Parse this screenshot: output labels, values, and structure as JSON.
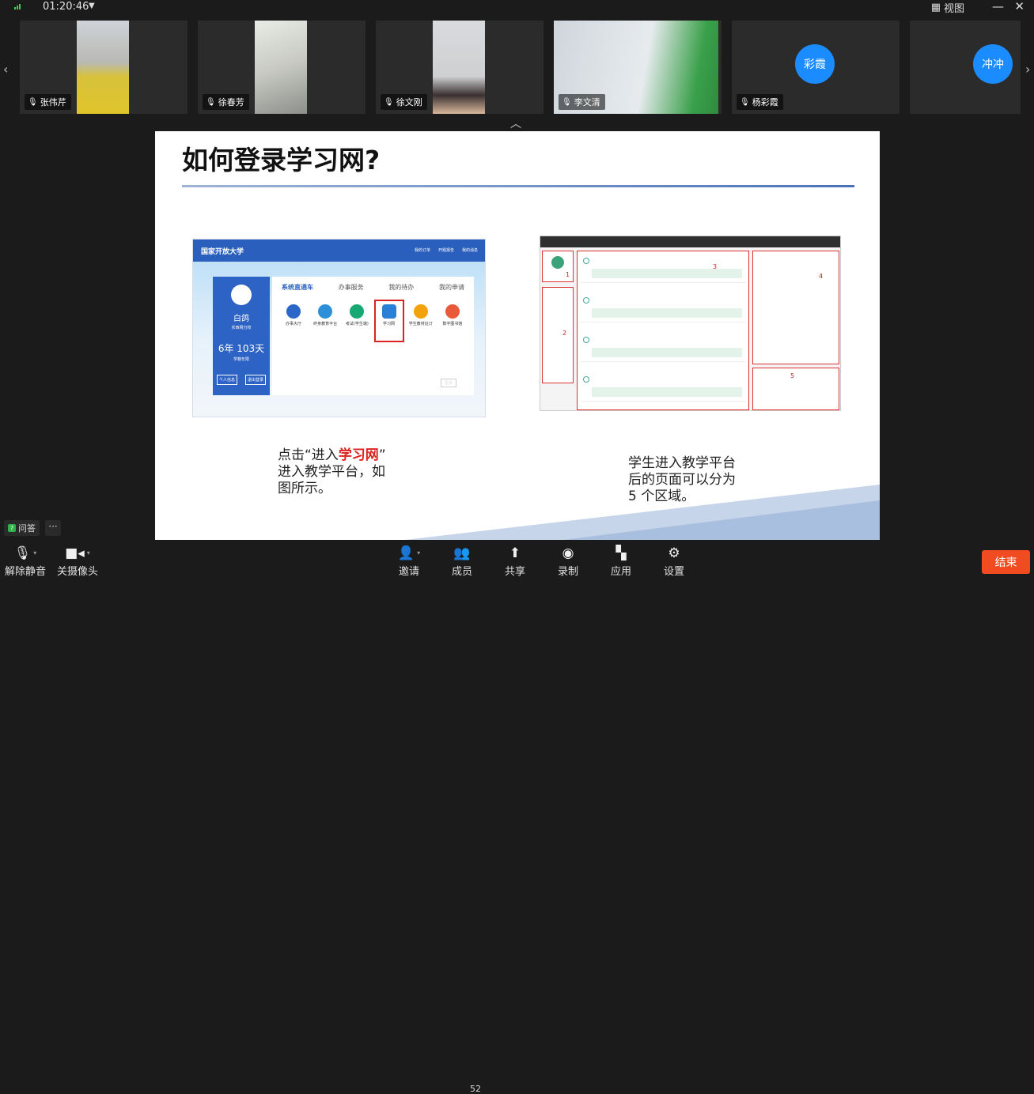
{
  "status": {
    "timer": "01:20:46",
    "view_label": "视图"
  },
  "participants": [
    {
      "name": "张伟芹",
      "video": true
    },
    {
      "name": "徐春芳",
      "video": true
    },
    {
      "name": "徐文刚",
      "video": true
    },
    {
      "name": "李文清",
      "video": true
    },
    {
      "name": "杨彩霞",
      "video": false,
      "avatar_text": "彩霞"
    },
    {
      "name": "",
      "video": false,
      "avatar_text": "冲冲"
    }
  ],
  "slide": {
    "title": "如何登录学习网?",
    "left_caption": {
      "pre": "点击“进入",
      "highlight": "学习网",
      "post": "”",
      "line2": "进入教学平台，如",
      "line3": "图所示。"
    },
    "right_caption": {
      "line1": "学生进入教学平台",
      "line2": "后的页面可以分为",
      "line3": "5 个区域。"
    },
    "shot1": {
      "brand": "国家开放大学",
      "nav": [
        "我的订单",
        "开题报告",
        "我的消息"
      ],
      "user_name": "白鸽",
      "school": "农西网分校",
      "duration": "6年 103天",
      "duration_sub": "学籍年限",
      "buttons": [
        "个人信息",
        "退出登录"
      ],
      "tabs": [
        "系统直通车",
        "办事服务",
        "我的待办",
        "我的申请"
      ],
      "icons": [
        {
          "label": "办事大厅",
          "color": "#2a67c8"
        },
        {
          "label": "终身教育平台",
          "color": "#2d8fd8"
        },
        {
          "label": "考试(学生端)",
          "color": "#18a874"
        },
        {
          "label": "学习网",
          "color": "#2a7fd6"
        },
        {
          "label": "学生教材征订",
          "color": "#f2a20b"
        },
        {
          "label": "数字图书馆",
          "color": "#e85a3a"
        }
      ],
      "more": "更多"
    },
    "shot2_region_numbers": [
      "1",
      "2",
      "3",
      "4",
      "5"
    ]
  },
  "bottom_left": {
    "qa_label": "问答",
    "more": "···"
  },
  "toolbar": {
    "unmute": "解除静音",
    "camera": "关摄像头",
    "invite": "邀请",
    "members": "成员",
    "member_count": "52",
    "share": "共享",
    "record": "录制",
    "apps": "应用",
    "settings": "设置",
    "end": "结束"
  },
  "colors": {
    "accent": "#1a8cff",
    "end": "#f04b21",
    "highlight": "#d22222"
  }
}
